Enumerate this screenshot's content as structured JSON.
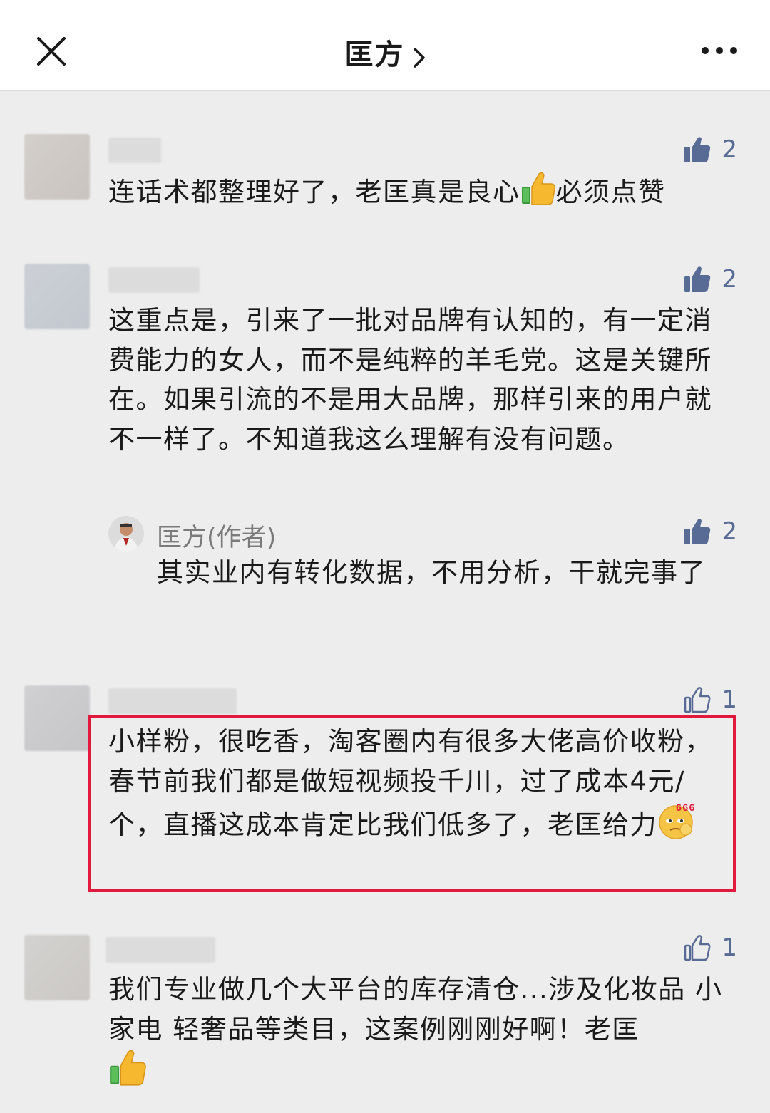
{
  "header": {
    "title": "匡方",
    "close_icon": "close-icon",
    "more_icon": "more-icon",
    "chevron_icon": "chevron-right-icon"
  },
  "comments": [
    {
      "likes": "2",
      "liked": true,
      "text": "连话术都整理好了，老匡真是良心",
      "text_after_emoji": "必须点赞"
    },
    {
      "likes": "2",
      "liked": true,
      "text": "这重点是，引来了一批对品牌有认知的，有一定消费能力的女人，而不是纯粹的羊毛党。这是关键所在。如果引流的不是用大品牌，那样引来的用户就不一样了。不知道我这么理解有没有问题。",
      "reply": {
        "author": "匡方(作者)",
        "likes": "2",
        "liked": true,
        "text": "其实业内有转化数据，不用分析，干就完事了"
      }
    },
    {
      "likes": "1",
      "liked": false,
      "text": "小样粉，很吃香，淘客圈内有很多大佬高价收粉，春节前我们都是做短视频投千川，过了成本4元/个，直播这成本肯定比我们低多了，老匡给力",
      "emoji_label": "666",
      "highlighted": true
    },
    {
      "likes": "1",
      "liked": false,
      "text": "我们专业做几个大平台的库存清仓...涉及化妆品 小家电 轻奢品等类目，这案例刚刚好啊！老匡"
    }
  ],
  "colors": {
    "accent_blue": "#576b95",
    "highlight_red": "#e0193d",
    "background": "#ededed"
  }
}
